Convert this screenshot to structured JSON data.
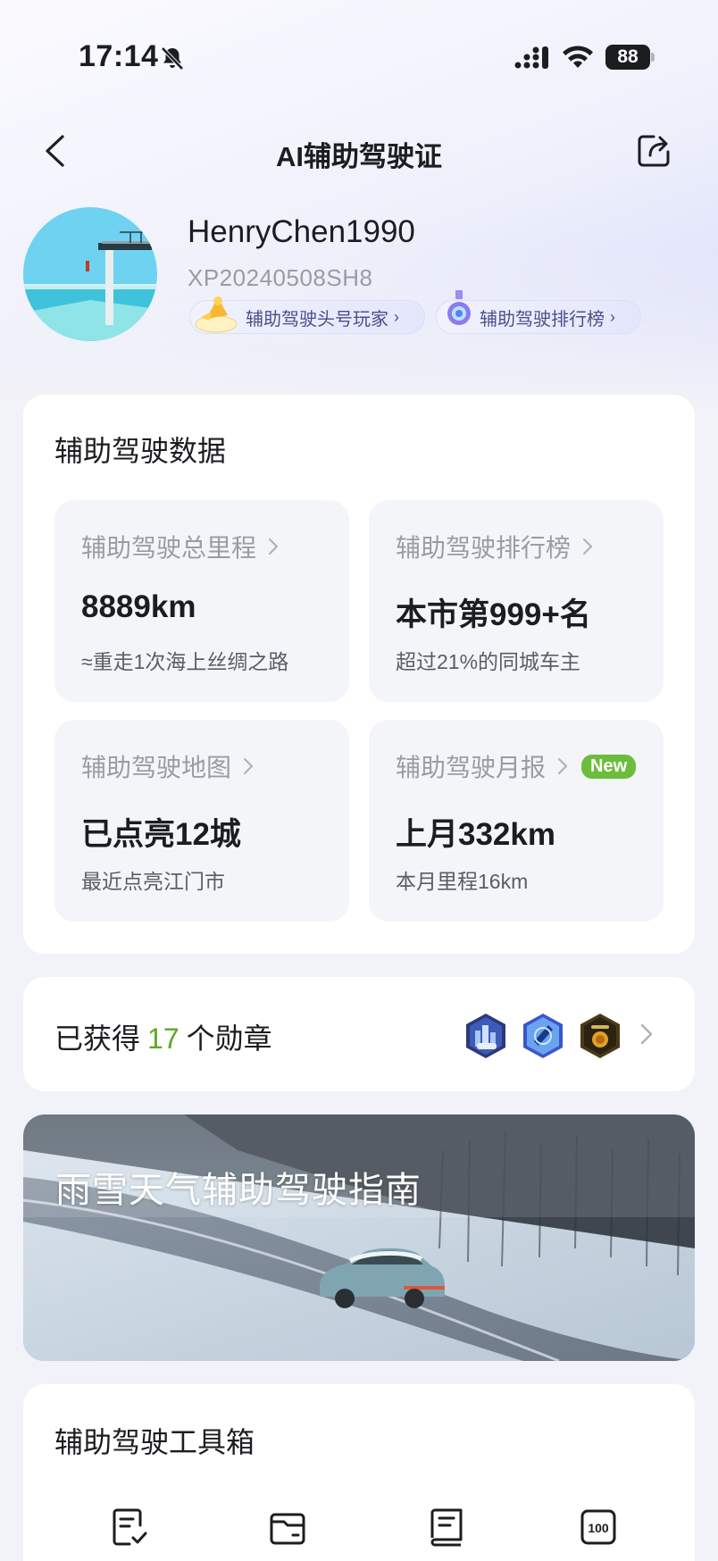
{
  "status_bar": {
    "time": "17:14",
    "battery": "88",
    "icons": [
      "bell-muted-icon",
      "signal-icon",
      "wifi-icon",
      "battery-icon"
    ]
  },
  "nav": {
    "title": "AI辅助驾驶证",
    "back_icon": "chevron-left-icon",
    "share_icon": "share-icon"
  },
  "profile": {
    "username": "HenryChen1990",
    "user_id": "XP20240508SH8",
    "tags": [
      {
        "label": "辅助驾驶头号玩家",
        "icon": "trophy-icon"
      },
      {
        "label": "辅助驾驶排行榜",
        "icon": "ranking-icon"
      }
    ]
  },
  "data_section": {
    "title": "辅助驾驶数据",
    "tiles": [
      {
        "label": "辅助驾驶总里程",
        "value": "8889km",
        "sub": "≈重走1次海上丝绸之路"
      },
      {
        "label": "辅助驾驶排行榜",
        "value": "本市第999+名",
        "sub": "超过21%的同城车主"
      },
      {
        "label": "辅助驾驶地图",
        "value": "已点亮12城",
        "sub": "最近点亮江门市"
      },
      {
        "label": "辅助驾驶月报",
        "value": "上月332km",
        "sub": "本月里程16km",
        "badge": "New"
      }
    ]
  },
  "badges": {
    "prefix": "已获得",
    "count": "17",
    "suffix": "个勋章",
    "medals": [
      "city-medal-icon",
      "tech-medal-icon",
      "gold-medal-icon"
    ],
    "accent": "#5fa726"
  },
  "banner": {
    "title": "雨雪天气辅助驾驶指南"
  },
  "toolbox": {
    "title": "辅助驾驶工具箱",
    "icons": [
      "checklist-icon",
      "wallet-icon",
      "manual-icon",
      "score-100-icon"
    ],
    "score_text": "100"
  },
  "colors": {
    "background": "#f2f3f8",
    "card": "#ffffff",
    "new_badge": "#6bbd3c",
    "tag_text": "#4b4f8a"
  }
}
